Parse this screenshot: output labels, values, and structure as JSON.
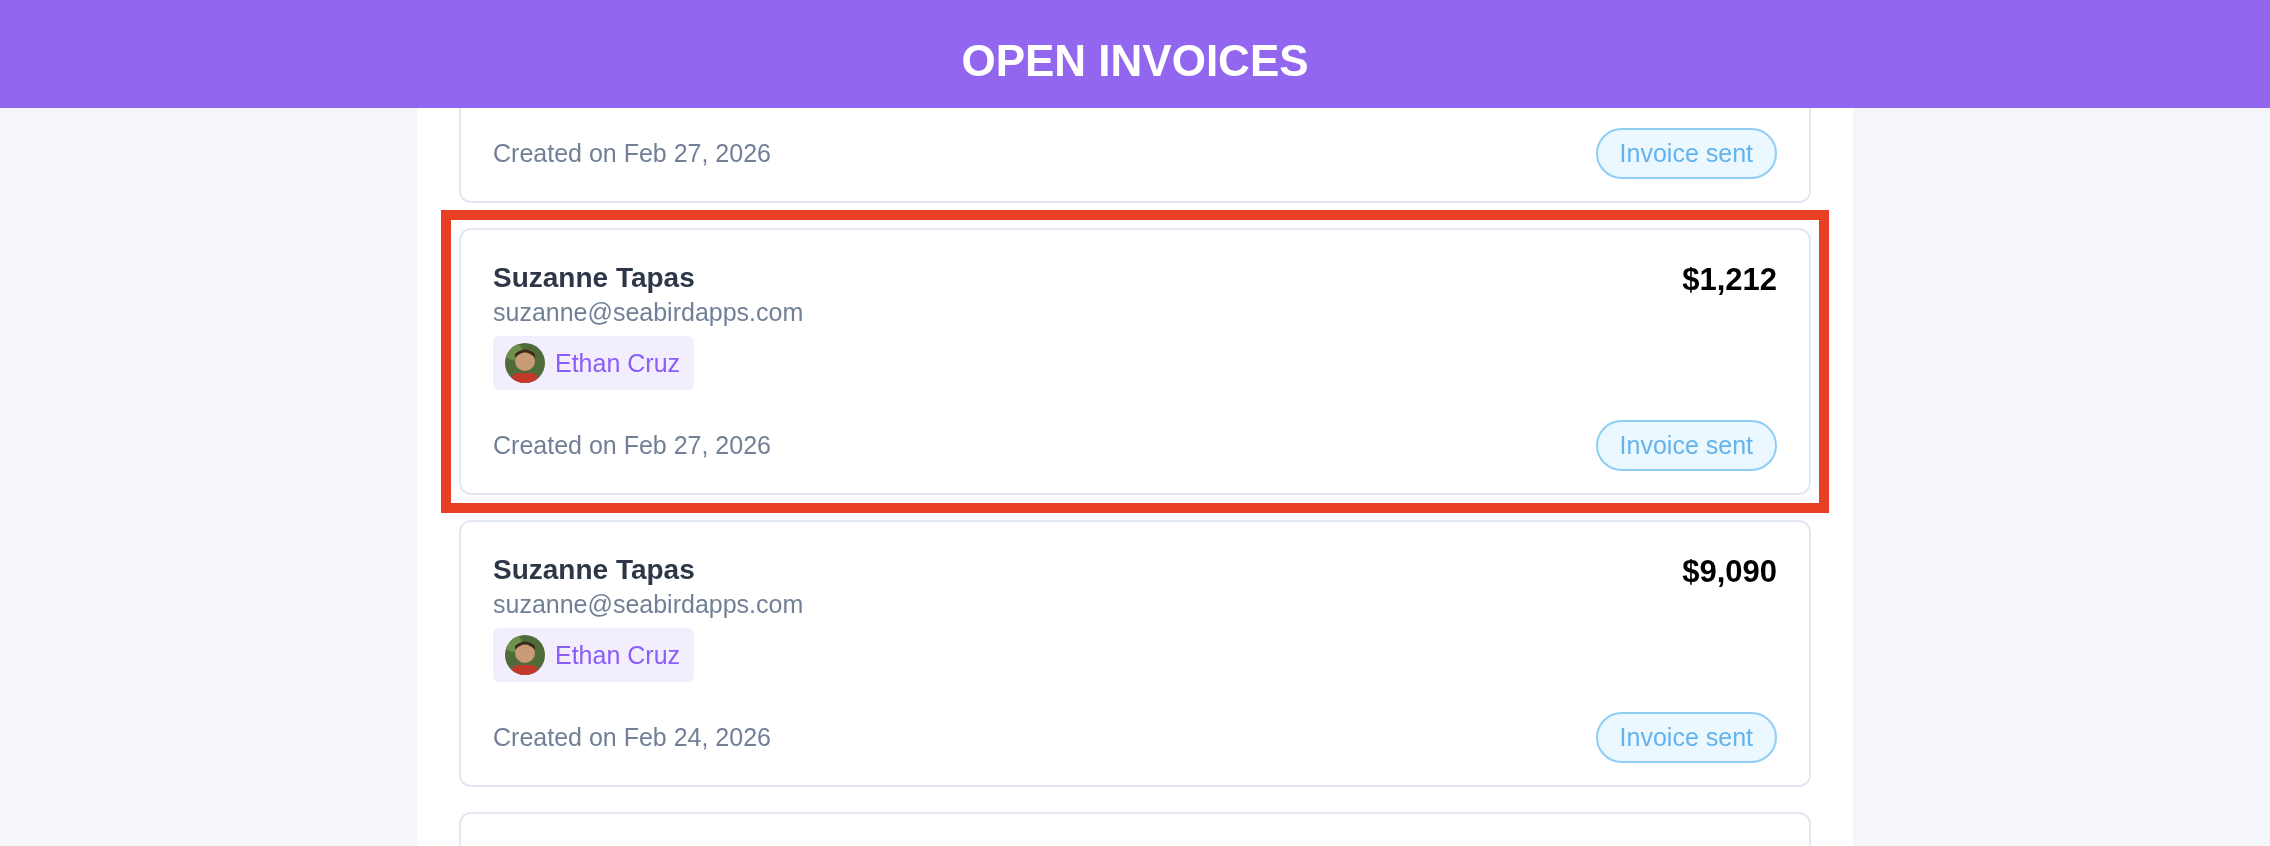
{
  "header": {
    "title": "OPEN INVOICES"
  },
  "invoices": [
    {
      "partial": true,
      "highlighted": false,
      "created": "Created on Feb 27, 2026",
      "status": "Invoice sent"
    },
    {
      "partial": false,
      "highlighted": true,
      "customer": "Suzanne Tapas",
      "email": "suzanne@seabirdapps.com",
      "amount": "$1,212",
      "assignee": "Ethan Cruz",
      "created": "Created on Feb 27, 2026",
      "status": "Invoice sent"
    },
    {
      "partial": false,
      "highlighted": false,
      "customer": "Suzanne Tapas",
      "email": "suzanne@seabirdapps.com",
      "amount": "$9,090",
      "assignee": "Ethan Cruz",
      "created": "Created on Feb 24, 2026",
      "status": "Invoice sent"
    },
    {
      "partial": true,
      "highlighted": false
    }
  ]
}
